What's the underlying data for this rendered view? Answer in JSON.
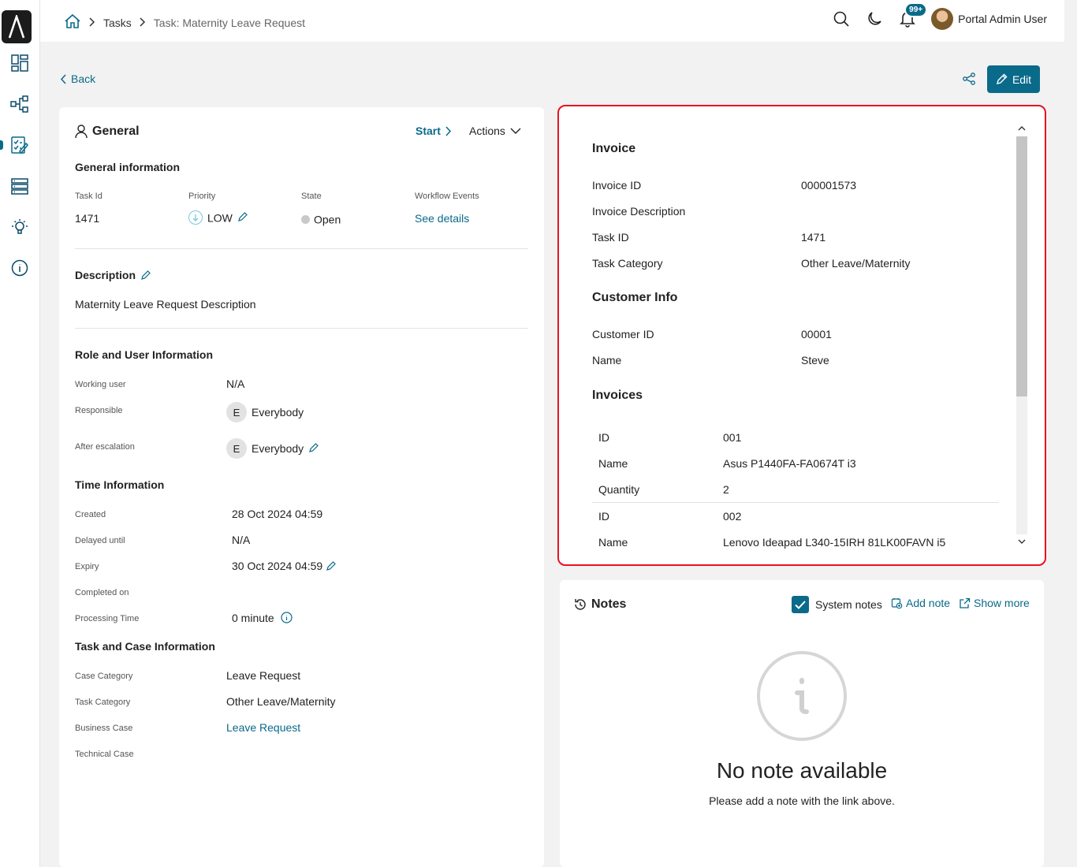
{
  "breadcrumb": {
    "tasks": "Tasks",
    "current": "Task: Maternity Leave Request"
  },
  "topbar": {
    "badge": "99+",
    "username": "Portal Admin User"
  },
  "toolbar": {
    "back": "Back",
    "edit": "Edit"
  },
  "general": {
    "title": "General",
    "start": "Start",
    "actions": "Actions",
    "info_title": "General information",
    "labels": {
      "task_id": "Task Id",
      "priority": "Priority",
      "state": "State",
      "workflow": "Workflow Events"
    },
    "values": {
      "task_id": "1471",
      "priority": "LOW",
      "state": "Open",
      "workflow": "See details"
    },
    "description_title": "Description",
    "description": "Maternity Leave Request Description",
    "role_title": "Role and User Information",
    "working_user_label": "Working user",
    "working_user": "N/A",
    "responsible_label": "Responsible",
    "responsible": "Everybody",
    "responsible_initial": "E",
    "after_escalation_label": "After escalation",
    "after_escalation": "Everybody",
    "after_escalation_initial": "E",
    "time_title": "Time Information",
    "created_label": "Created",
    "created": "28 Oct 2024 04:59",
    "delayed_label": "Delayed until",
    "delayed": "N/A",
    "expiry_label": "Expiry",
    "expiry": "30 Oct 2024 04:59",
    "completed_label": "Completed on",
    "processing_label": "Processing Time",
    "processing": "0 minute",
    "case_title": "Task and Case Information",
    "case_category_label": "Case Category",
    "case_category": "Leave Request",
    "task_category_label": "Task Category",
    "task_category": "Other Leave/Maternity",
    "business_case_label": "Business Case",
    "business_case": "Leave Request",
    "technical_case_label": "Technical Case"
  },
  "invoice": {
    "title": "Invoice",
    "rows": [
      {
        "label": "Invoice ID",
        "value": "000001573"
      },
      {
        "label": "Invoice Description",
        "value": ""
      },
      {
        "label": "Task ID",
        "value": "1471"
      },
      {
        "label": "Task Category",
        "value": "Other Leave/Maternity"
      }
    ],
    "customer_title": "Customer Info",
    "customer_rows": [
      {
        "label": "Customer ID",
        "value": "00001"
      },
      {
        "label": "Name",
        "value": "Steve"
      }
    ],
    "invoices_title": "Invoices",
    "items": [
      {
        "id_label": "ID",
        "id": "001",
        "name_label": "Name",
        "name": "Asus P1440FA-FA0674T i3",
        "qty_label": "Quantity",
        "qty": "2"
      },
      {
        "id_label": "ID",
        "id": "002",
        "name_label": "Name",
        "name": "Lenovo Ideapad L340-15IRH 81LK00FAVN i5"
      }
    ]
  },
  "notes": {
    "title": "Notes",
    "system_notes": "System notes",
    "add_note": "Add note",
    "show_more": "Show more",
    "empty_title": "No note available",
    "empty_sub": "Please add a note with the link above."
  },
  "colors": {
    "accent": "#0a6a8a",
    "highlight_border": "#e8121e"
  }
}
